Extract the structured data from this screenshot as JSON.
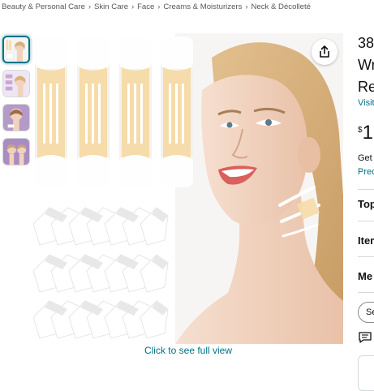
{
  "breadcrumb": [
    "Beauty & Personal Care",
    "Skin Care",
    "Face",
    "Creams & Moisturizers",
    "Neck & Décolleté"
  ],
  "gallery": {
    "thumbnails": [
      "thumbnail-1",
      "thumbnail-2",
      "thumbnail-3",
      "thumbnail-4"
    ],
    "selected_index": 0,
    "full_view_link": "Click to see full view",
    "share_icon": "share-icon"
  },
  "product": {
    "title_lines": [
      "38",
      "Wr",
      "Re"
    ],
    "visit_link": "Visit",
    "price_currency": "$",
    "price_whole": "1",
    "delivery_text": "Get",
    "delivery_link": "Prec"
  },
  "sections": {
    "top": "Top",
    "item": "Item",
    "more": "Me"
  },
  "pill_label": "Se",
  "colors": {
    "link": "#007185",
    "patch": "#f6dcaa",
    "skin": "#f1d2bd"
  }
}
